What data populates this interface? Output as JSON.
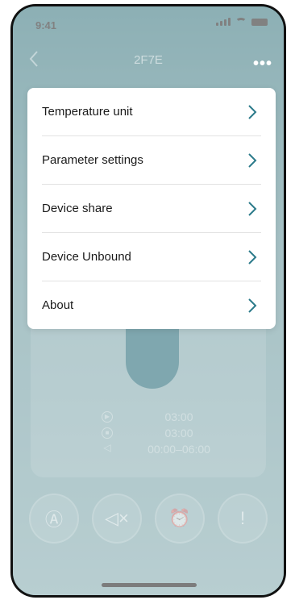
{
  "status_bar": {
    "time": "9:41"
  },
  "nav": {
    "title": "2F7E",
    "more_label": "•••"
  },
  "menu": {
    "items": [
      {
        "label": "Temperature unit"
      },
      {
        "label": "Parameter settings"
      },
      {
        "label": "Device share"
      },
      {
        "label": "Device Unbound"
      },
      {
        "label": "About"
      }
    ]
  },
  "timers": [
    {
      "icon": "play-icon",
      "value": "03:00"
    },
    {
      "icon": "stop-icon",
      "value": "03:00"
    },
    {
      "icon": "mute-icon",
      "value": "00:00–06:00"
    }
  ],
  "bottom_buttons": [
    {
      "icon": "auto-mode-icon",
      "glyph": "Ⓐ"
    },
    {
      "icon": "mute-icon",
      "glyph": "◁×"
    },
    {
      "icon": "alarm-clock-icon",
      "glyph": "⏰"
    },
    {
      "icon": "alert-icon",
      "glyph": "!"
    }
  ],
  "colors": {
    "accent": "#16606e",
    "background": "#2f6f78",
    "chevron": "#2b7a8a"
  }
}
